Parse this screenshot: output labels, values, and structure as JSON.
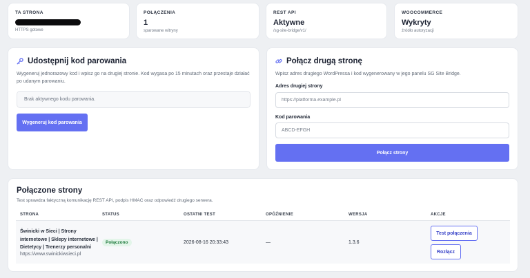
{
  "stats": [
    {
      "label": "TA STRONA",
      "value": "",
      "sub": "HTTPS gotowe",
      "redacted": true
    },
    {
      "label": "POŁĄCZENIA",
      "value": "1",
      "sub": "sparowane witryny"
    },
    {
      "label": "REST API",
      "value": "Aktywne",
      "sub": "/sg-site-bridge/v1/"
    },
    {
      "label": "WOOCOMMERCE",
      "value": "Wykryty",
      "sub": "źródło autoryzacji"
    }
  ],
  "share_panel": {
    "icon": "key-icon",
    "title": "Udostępnij kod parowania",
    "description": "Wygeneruj jednorazowy kod i wpisz go na drugiej stronie. Kod wygasa po 15 minutach oraz przestaje działać po udanym parowaniu.",
    "empty_text": "Brak aktywnego kodu parowania.",
    "generate_button": "Wygeneruj kod parowania"
  },
  "connect_panel": {
    "icon": "link-icon",
    "title": "Połącz drugą stronę",
    "description": "Wpisz adres drugiego WordPressa i kod wygenerowany w jego panelu SG Site Bridge.",
    "address_label": "Adres drugiej strony",
    "address_placeholder": "https://platforma.example.pl",
    "code_label": "Kod parowania",
    "code_placeholder": "ABCD-EFGH",
    "connect_button": "Połącz strony"
  },
  "connected": {
    "title": "Połączone strony",
    "description": "Test sprawdza faktyczną komunikację REST API, podpis HMAC oraz odpowiedź drugiego serwera.",
    "columns": [
      "STRONA",
      "STATUS",
      "OSTATNI TEST",
      "OPÓŹNIENIE",
      "WERSJA",
      "AKCJE"
    ],
    "rows": [
      {
        "name": "Świnicki w Sieci | Strony internetowe | Sklepy internetowe | Dietetycy | Trenerzy personalni",
        "url": "https://www.swinickiwsieci.pl",
        "status": "Połączono",
        "last_test": "2026-08-16 20:33:43",
        "latency": "—",
        "version": "1.3.6",
        "test_button": "Test połączenia",
        "disconnect_button": "Rozłącz"
      }
    ]
  },
  "colors": {
    "accent": "#6470f2",
    "background": "#eef0f3",
    "success_bg": "#e3f5e9",
    "success_text": "#1f7a3d"
  }
}
